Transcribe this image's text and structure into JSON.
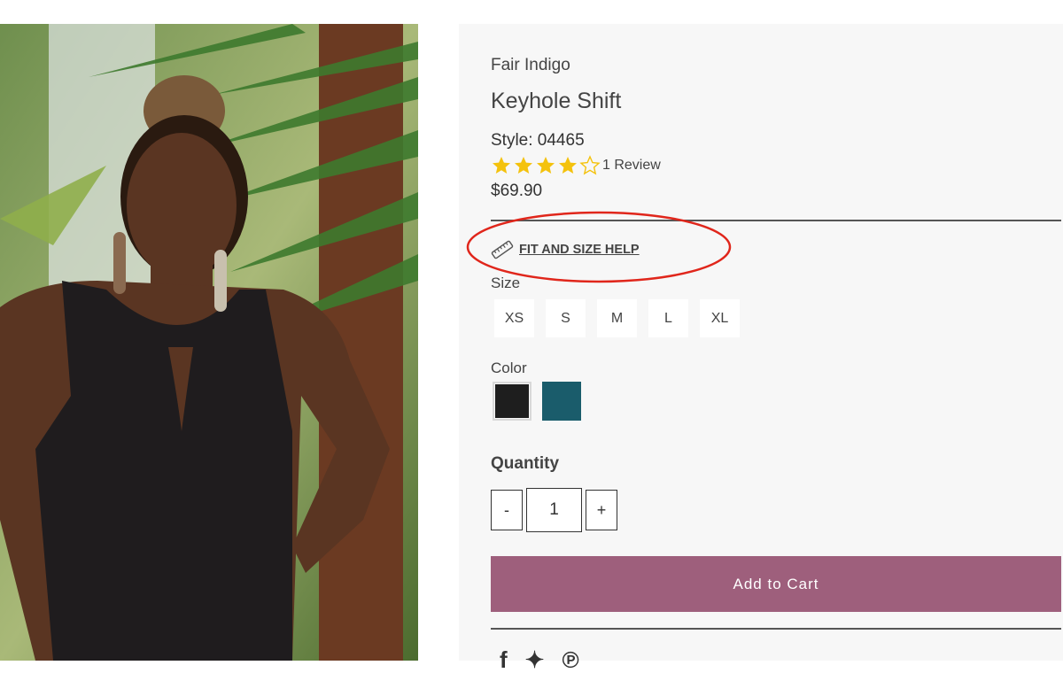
{
  "product": {
    "brand": "Fair Indigo",
    "title": "Keyhole Shift",
    "style": "Style: 04465",
    "rating": 4,
    "rating_max": 5,
    "review_label": "1 Review",
    "price": "$69.90"
  },
  "fit_help": {
    "label": "FIT AND SIZE HELP",
    "icon": "ruler-icon"
  },
  "size": {
    "label": "Size",
    "options": [
      "XS",
      "S",
      "M",
      "L",
      "XL"
    ]
  },
  "color": {
    "label": "Color",
    "swatches": [
      {
        "name": "black-swatch",
        "hex": "#1e1e1e",
        "selected": true
      },
      {
        "name": "teal-swatch",
        "hex": "#1a5c6b",
        "selected": false
      }
    ]
  },
  "quantity": {
    "label": "Quantity",
    "minus": "-",
    "value": "1",
    "plus": "+"
  },
  "cart": {
    "label": "Add to Cart"
  },
  "colors": {
    "accent": "#9e5f7c",
    "star": "#f4c20d",
    "annotation": "#e0261b"
  },
  "social": {
    "icons": [
      "facebook-icon",
      "twitter-icon",
      "pinterest-icon"
    ]
  }
}
